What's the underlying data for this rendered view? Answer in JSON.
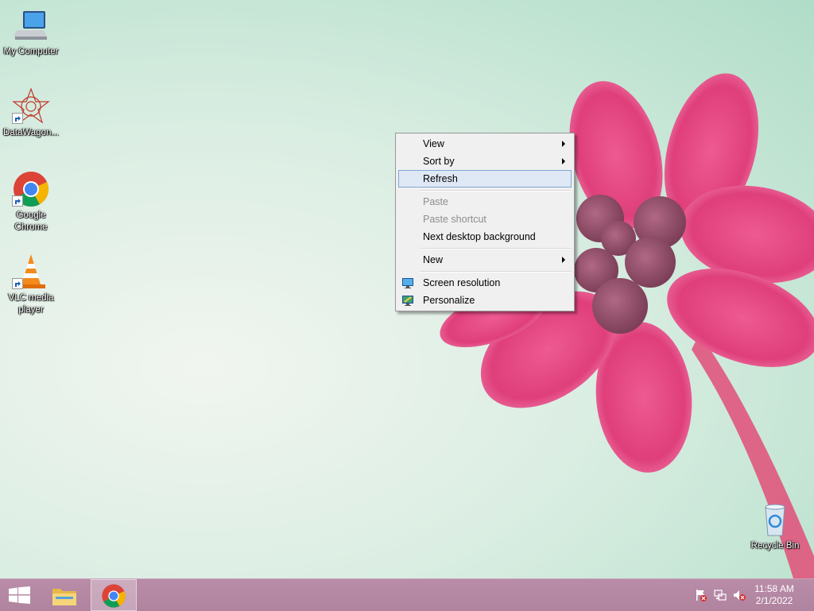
{
  "desktop": {
    "icons": [
      {
        "label": "My Computer",
        "icon": "my-computer-icon"
      },
      {
        "label": "DataWagon...",
        "icon": "datawagon-icon"
      },
      {
        "label": "Google Chrome",
        "icon": "google-chrome-icon"
      },
      {
        "label": "VLC media player",
        "icon": "vlc-icon"
      },
      {
        "label": "Recycle Bin",
        "icon": "recycle-bin-icon"
      }
    ]
  },
  "context_menu": {
    "items": [
      {
        "label": "View",
        "has_submenu": true,
        "state": "normal"
      },
      {
        "label": "Sort by",
        "has_submenu": true,
        "state": "normal"
      },
      {
        "label": "Refresh",
        "state": "highlighted"
      },
      {
        "label": "Paste",
        "state": "disabled"
      },
      {
        "label": "Paste shortcut",
        "state": "disabled"
      },
      {
        "label": "Next desktop background",
        "state": "normal"
      },
      {
        "label": "New",
        "has_submenu": true,
        "state": "normal"
      },
      {
        "label": "Screen resolution",
        "icon": "screen-resolution-icon",
        "state": "normal"
      },
      {
        "label": "Personalize",
        "icon": "personalize-icon",
        "state": "normal"
      }
    ]
  },
  "taskbar": {
    "pinned": [
      {
        "name": "start",
        "icon": "windows-logo-icon"
      },
      {
        "name": "file-explorer",
        "icon": "folder-icon"
      },
      {
        "name": "google-chrome",
        "icon": "chrome-icon",
        "active": true
      }
    ],
    "tray": {
      "icons": [
        "action-center-flag-icon",
        "network-icon",
        "volume-muted-icon"
      ],
      "time": "11:58 AM",
      "date": "2/1/2022"
    }
  },
  "colors": {
    "taskbar": "#b0839f",
    "menu_highlight": "#dfe9f5",
    "flower": "#e0467e"
  }
}
